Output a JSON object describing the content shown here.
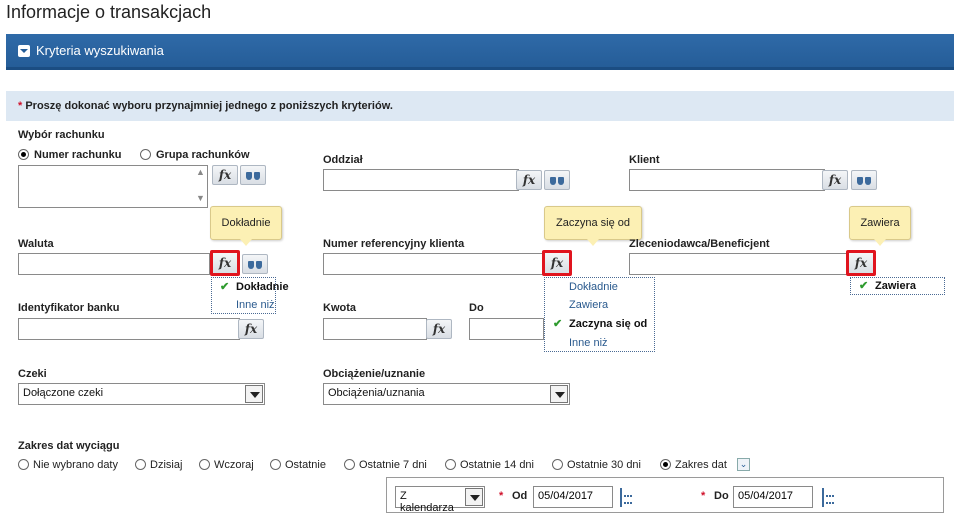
{
  "page_title": "Informacje o transakcjach",
  "section": {
    "label": "Kryteria wyszukiwania"
  },
  "hint": {
    "star": "*",
    "text": "Proszę dokonać wyboru przynajmniej jednego z poniższych kryteriów."
  },
  "account_choice": {
    "label": "Wybór rachunku",
    "opt_number": "Numer rachunku",
    "opt_group": "Grupa rachunków",
    "selected": "Numer rachunku"
  },
  "fields": {
    "branch": "Oddział",
    "client": "Klient",
    "currency": "Waluta",
    "client_ref": "Numer referencyjny klienta",
    "payee": "Zleceniodawca/Beneficjent",
    "bank_id": "Identyfikator banku",
    "amount": "Kwota",
    "amount_to": "Do",
    "cheques": "Czeki",
    "debit_credit": "Obciążenie/uznanie"
  },
  "fx_label": "fx",
  "tooltips": {
    "currency": "Dokładnie",
    "client_ref": "Zaczyna się od",
    "payee": "Zawiera"
  },
  "menus": {
    "currency": {
      "items": [
        "Dokładnie",
        "Inne niż"
      ],
      "selected": "Dokładnie"
    },
    "client_ref": {
      "items": [
        "Dokładnie",
        "Zawiera",
        "Zaczyna się od",
        "Inne niż"
      ],
      "selected": "Zaczyna się od"
    },
    "payee": {
      "items": [
        "Zawiera"
      ],
      "selected": "Zawiera"
    }
  },
  "check_mark": "✔",
  "selects": {
    "cheques_value": "Dołączone czeki",
    "debit_credit_value": "Obciążenia/uznania"
  },
  "date_range": {
    "label": "Zakres dat wyciągu",
    "options": [
      "Nie wybrano daty",
      "Dzisiaj",
      "Wczoraj",
      "Ostatnie",
      "Ostatnie 7 dni",
      "Ostatnie 14 dni",
      "Ostatnie 30 dni",
      "Zakres dat"
    ],
    "selected": "Zakres dat",
    "calendar_type": "Z kalendarza",
    "from_label": "Od",
    "from_value": "05/04/2017",
    "to_label": "Do",
    "to_value": "05/04/2017"
  },
  "colors": {
    "accent": "#255d98",
    "highlight": "#e0141e",
    "tooltip": "#fcf0b4",
    "required": "#d0112b"
  }
}
